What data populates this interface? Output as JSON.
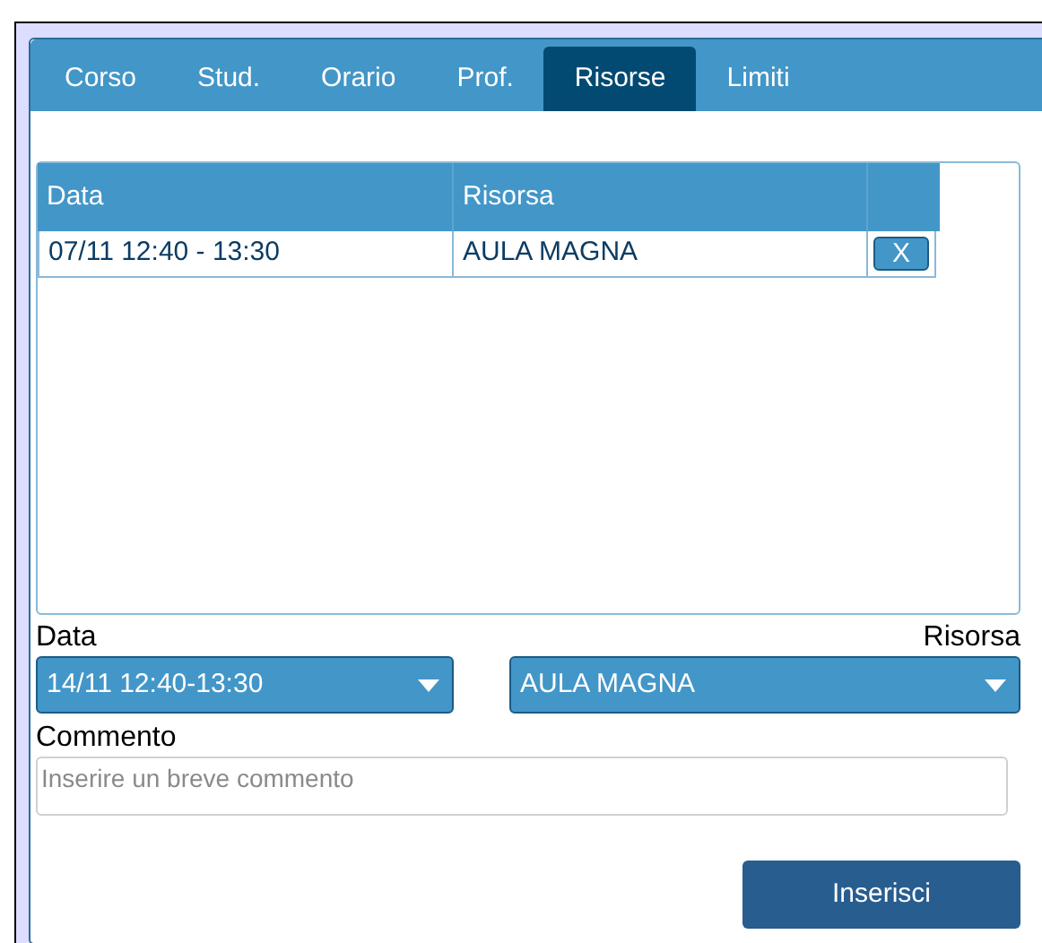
{
  "tabs": [
    {
      "label": "Corso",
      "selected": false
    },
    {
      "label": "Stud.",
      "selected": false
    },
    {
      "label": "Orario",
      "selected": false
    },
    {
      "label": "Prof.",
      "selected": false
    },
    {
      "label": "Risorse",
      "selected": true
    },
    {
      "label": "Limiti",
      "selected": false
    }
  ],
  "table": {
    "columns": [
      "Data",
      "Risorsa"
    ],
    "rows": [
      {
        "data": "07/11 12:40 - 13:30",
        "risorsa": "AULA MAGNA",
        "delete": "X"
      }
    ]
  },
  "form": {
    "data_label": "Data",
    "data_value": "14/11 12:40-13:30",
    "risorsa_label": "Risorsa",
    "risorsa_value": "AULA MAGNA",
    "comment_label": "Commento",
    "comment_placeholder": "Inserire un breve commento",
    "submit": "Inserisci"
  }
}
